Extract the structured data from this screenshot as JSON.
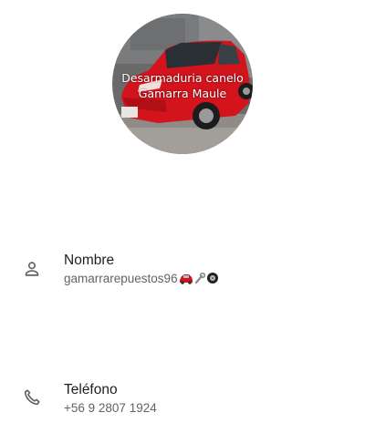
{
  "profile": {
    "photo_caption_line1": "Desarmaduria canelo",
    "photo_caption_line2": "Gamarra Maule",
    "photo_icon": "profile-photo"
  },
  "fields": {
    "name": {
      "label": "Nombre",
      "value": "gamarrarepuestos96",
      "icon": "person-icon"
    },
    "phone": {
      "label": "Teléfono",
      "value": "+56 9 2807 1924",
      "icon": "phone-icon"
    }
  },
  "colors": {
    "label": "#1f1f1f",
    "value": "#5f6368",
    "icon": "#5f6368",
    "car": "#d3141c"
  }
}
